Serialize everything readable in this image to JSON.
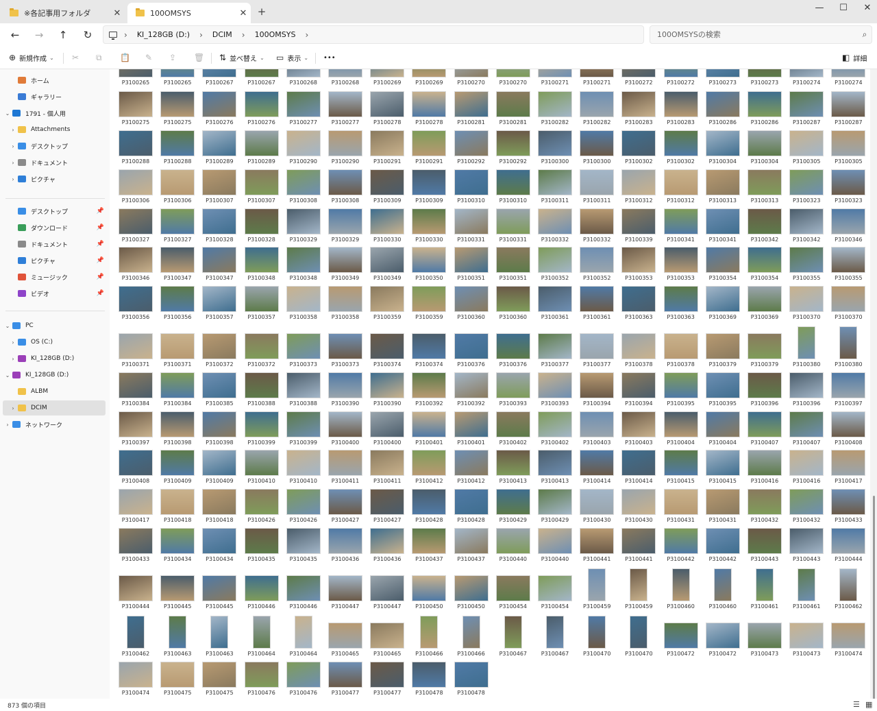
{
  "window": {
    "tabs": [
      {
        "label": "※各記事用フォルダ",
        "close": "✕"
      },
      {
        "label": "100OMSYS",
        "close": "✕"
      }
    ],
    "new_tab": "+",
    "controls": {
      "minimize": "—",
      "maximize": "☐",
      "close": "✕"
    }
  },
  "address_bar": {
    "back": "←",
    "forward": "→",
    "up": "↑",
    "refresh": "↻",
    "breadcrumb": [
      "KI_128GB (D:)",
      "DCIM",
      "100OMSYS"
    ],
    "separator": "›",
    "search_placeholder": "100OMSYSの検索"
  },
  "toolbar": {
    "new_label": "新規作成",
    "sort_label": "並べ替え",
    "view_label": "表示",
    "more_label": "•••",
    "details_label": "詳細"
  },
  "sidebar": {
    "items": [
      {
        "label": "ホーム",
        "color": "#e07b39",
        "expand": ""
      },
      {
        "label": "ギャラリー",
        "color": "#3a7bd5",
        "expand": ""
      },
      {
        "label": "1791 - 個人用",
        "color": "#1e78d4",
        "expand": "⌄"
      },
      {
        "label": "Attachments",
        "color": "#f0c24a",
        "expand": "›"
      },
      {
        "label": "デスクトップ",
        "color": "#3a8ee6",
        "expand": "›"
      },
      {
        "label": "ドキュメント",
        "color": "#8a8a8a",
        "expand": "›"
      },
      {
        "label": "ピクチャ",
        "color": "#2f7fd8",
        "expand": "›"
      }
    ],
    "quick_access": [
      {
        "label": "デスクトップ",
        "color": "#3a8ee6"
      },
      {
        "label": "ダウンロード",
        "color": "#3a9e5a"
      },
      {
        "label": "ドキュメント",
        "color": "#8a8a8a"
      },
      {
        "label": "ピクチャ",
        "color": "#2f7fd8"
      },
      {
        "label": "ミュージック",
        "color": "#e0533a"
      },
      {
        "label": "ビデオ",
        "color": "#8e44c9"
      }
    ],
    "pin_glyph": "📌",
    "tree": [
      {
        "label": "PC",
        "color": "#3a8ee6",
        "expand": "⌄"
      },
      {
        "label": "OS (C:)",
        "color": "#3a8ee6",
        "expand": "›"
      },
      {
        "label": "KI_128GB (D:)",
        "color": "#9b3fb8",
        "expand": "›"
      },
      {
        "label": "KI_128GB (D:)",
        "color": "#9b3fb8",
        "expand": "⌄"
      },
      {
        "label": "ALBM",
        "color": "#f0c24a",
        "expand": ""
      },
      {
        "label": "DCIM",
        "color": "#f0c24a",
        "expand": "›"
      },
      {
        "label": "ネットワーク",
        "color": "#3a8ee6",
        "expand": "›"
      }
    ]
  },
  "files": [
    "P3100265",
    "P3100265",
    "P3100267",
    "P3100267",
    "P3100268",
    "P3100268",
    "P3100269",
    "P3100269",
    "P3100270",
    "P3100270",
    "P3100271",
    "P3100271",
    "P3100272",
    "P3100272",
    "P3100273",
    "P3100273",
    "P3100274",
    "P3100274",
    "P3100275",
    "P3100275",
    "P3100276",
    "P3100276",
    "P3100277",
    "P3100277",
    "P3100278",
    "P3100278",
    "P3100281",
    "P3100281",
    "P3100282",
    "P3100282",
    "P3100283",
    "P3100283",
    "P3100286",
    "P3100286",
    "P3100287",
    "P3100287",
    "P3100288",
    "P3100288",
    "P3100289",
    "P3100289",
    "P3100290",
    "P3100290",
    "P3100291",
    "P3100291",
    "P3100292",
    "P3100292",
    "P3100300",
    "P3100300",
    "P3100302",
    "P3100302",
    "P3100304",
    "P3100304",
    "P3100305",
    "P3100305",
    "P3100306",
    "P3100306",
    "P3100307",
    "P3100307",
    "P3100308",
    "P3100308",
    "P3100309",
    "P3100309",
    "P3100310",
    "P3100310",
    "P3100311",
    "P3100311",
    "P3100312",
    "P3100312",
    "P3100313",
    "P3100313",
    "P3100323",
    "P3100323",
    "P3100327",
    "P3100327",
    "P3100328",
    "P3100328",
    "P3100329",
    "P3100329",
    "P3100330",
    "P3100330",
    "P3100331",
    "P3100331",
    "P3100332",
    "P3100332",
    "P3100339",
    "P3100341",
    "P3100341",
    "P3100342",
    "P3100342",
    "P3100346",
    "P3100346",
    "P3100347",
    "P3100347",
    "P3100348",
    "P3100348",
    "P3100349",
    "P3100349",
    "P3100350",
    "P3100351",
    "P3100351",
    "P3100352",
    "P3100352",
    "P3100353",
    "P3100353",
    "P3100354",
    "P3100354",
    "P3100355",
    "P3100355",
    "P3100356",
    "P3100356",
    "P3100357",
    "P3100357",
    "P3100358",
    "P3100358",
    "P3100359",
    "P3100359",
    "P3100360",
    "P3100360",
    "P3100361",
    "P3100361",
    "P3100363",
    "P3100363",
    "P3100369",
    "P3100369",
    "P3100370",
    "P3100370",
    "P3100371",
    "P3100371",
    "P3100372",
    "P3100372",
    "P3100373",
    "P3100373",
    "P3100374",
    "P3100374",
    "P3100376",
    "P3100376",
    "P3100377",
    "P3100377",
    "P3100378",
    "P3100378",
    "P3100379",
    "P3100379",
    "P3100380",
    "P3100380",
    "P3100384",
    "P3100384",
    "P3100385",
    "P3100388",
    "P3100388",
    "P3100390",
    "P3100390",
    "P3100392",
    "P3100392",
    "P3100393",
    "P3100393",
    "P3100394",
    "P3100394",
    "P3100395",
    "P3100395",
    "P3100396",
    "P3100396",
    "P3100397",
    "P3100397",
    "P3100398",
    "P3100398",
    "P3100399",
    "P3100399",
    "P3100400",
    "P3100400",
    "P3100401",
    "P3100401",
    "P3100402",
    "P3100402",
    "P3100403",
    "P3100403",
    "P3100404",
    "P3100404",
    "P3100407",
    "P3100407",
    "P3100408",
    "P3100408",
    "P3100409",
    "P3100409",
    "P3100410",
    "P3100410",
    "P3100411",
    "P3100411",
    "P3100412",
    "P3100412",
    "P3100413",
    "P3100413",
    "P3100414",
    "P3100414",
    "P3100415",
    "P3100415",
    "P3100416",
    "P3100416",
    "P3100417",
    "P3100417",
    "P3100418",
    "P3100418",
    "P3100426",
    "P3100426",
    "P3100427",
    "P3100427",
    "P3100428",
    "P3100428",
    "P3100429",
    "P3100429",
    "P3100430",
    "P3100430",
    "P3100431",
    "P3100431",
    "P3100432",
    "P3100432",
    "P3100433",
    "P3100433",
    "P3100434",
    "P3100434",
    "P3100435",
    "P3100435",
    "P3100436",
    "P3100436",
    "P3100437",
    "P3100437",
    "P3100440",
    "P3100440",
    "P3100441",
    "P3100441",
    "P3100442",
    "P3100442",
    "P3100443",
    "P3100443",
    "P3100444",
    "P3100444",
    "P3100445",
    "P3100445",
    "P3100446",
    "P3100446",
    "P3100447",
    "P3100447",
    "P3100450",
    "P3100450",
    "P3100454",
    "P3100454",
    "P3100459",
    "P3100459",
    "P3100460",
    "P3100460",
    "P3100461",
    "P3100461",
    "P3100462",
    "P3100462",
    "P3100463",
    "P3100463",
    "P3100464",
    "P3100464",
    "P3100465",
    "P3100465",
    "P3100466",
    "P3100466",
    "P3100467",
    "P3100467",
    "P3100470",
    "P3100470",
    "P3100472",
    "P3100472",
    "P3100473",
    "P3100473",
    "P3100474",
    "P3100474",
    "P3100475",
    "P3100475",
    "P3100476",
    "P3100476",
    "P3100477",
    "P3100477",
    "P3100478",
    "P3100478"
  ],
  "thumb_palette": [
    "#8a7a5e",
    "#5d7b4a",
    "#6e8fb3",
    "#9aa5ad",
    "#4b5d6b",
    "#b89a72",
    "#3f6e8f",
    "#7f9c5a",
    "#a3b6c8",
    "#6b5a48",
    "#c9b28d",
    "#507aa6"
  ],
  "status": {
    "count": "873 個の項目",
    "list_view": "☰",
    "grid_view": "▦"
  }
}
